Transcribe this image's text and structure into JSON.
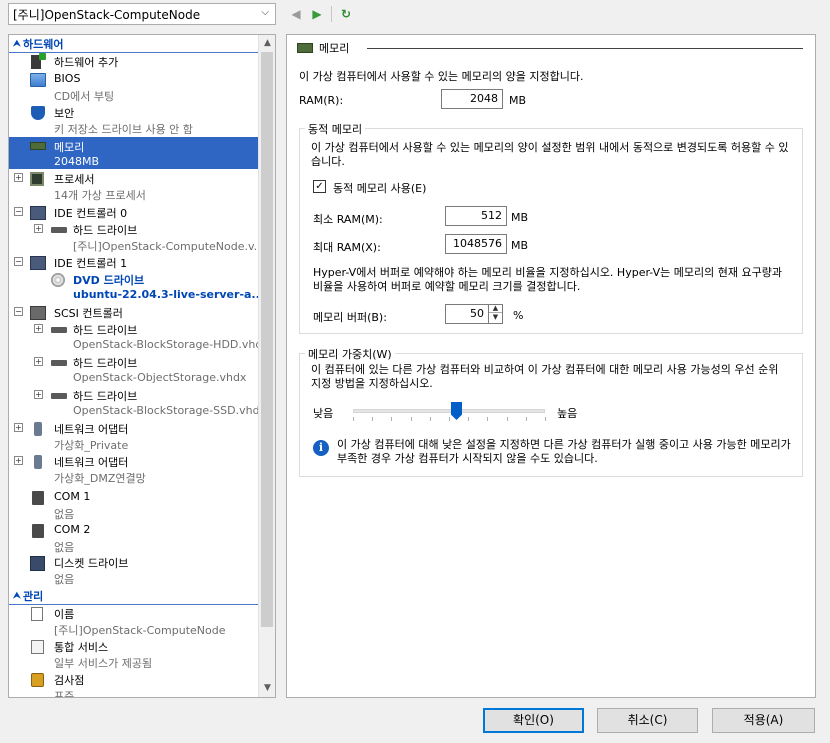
{
  "toolbar": {
    "vm_name": "[주니]OpenStack-ComputeNode",
    "back": "◀",
    "forward": "▶",
    "refresh": "↻"
  },
  "sidebar": {
    "hardware_header": "하드웨어",
    "management_header": "관리",
    "items": [
      {
        "title": "하드웨어 추가",
        "sub": ""
      },
      {
        "title": "BIOS",
        "sub": "CD에서 부팅"
      },
      {
        "title": "보안",
        "sub": "키 저장소 드라이브 사용 안 함"
      },
      {
        "title": "메모리",
        "sub": "2048MB"
      },
      {
        "title": "프로세서",
        "sub": "14개 가상 프로세서"
      },
      {
        "title": "IDE 컨트롤러 0",
        "sub": ""
      },
      {
        "title": "하드 드라이브",
        "sub": "[주니]OpenStack-ComputeNode.v..."
      },
      {
        "title": "IDE 컨트롤러 1",
        "sub": ""
      },
      {
        "title": "DVD 드라이브",
        "sub": "ubuntu-22.04.3-live-server-a..."
      },
      {
        "title": "SCSI 컨트롤러",
        "sub": ""
      },
      {
        "title": "하드 드라이브",
        "sub": "OpenStack-BlockStorage-HDD.vhdx"
      },
      {
        "title": "하드 드라이브",
        "sub": "OpenStack-ObjectStorage.vhdx"
      },
      {
        "title": "하드 드라이브",
        "sub": "OpenStack-BlockStorage-SSD.vhdx"
      },
      {
        "title": "네트워크 어댑터",
        "sub": "가상화_Private"
      },
      {
        "title": "네트워크 어댑터",
        "sub": "가상화_DMZ연결망"
      },
      {
        "title": "COM 1",
        "sub": "없음"
      },
      {
        "title": "COM 2",
        "sub": "없음"
      },
      {
        "title": "디스켓 드라이브",
        "sub": "없음"
      },
      {
        "title": "이름",
        "sub": "[주니]OpenStack-ComputeNode"
      },
      {
        "title": "통합 서비스",
        "sub": "일부 서비스가 제공됨"
      },
      {
        "title": "검사점",
        "sub": "표준"
      }
    ]
  },
  "memory": {
    "header": "메모리",
    "description": "이 가상 컴퓨터에서 사용할 수 있는 메모리의 양을 지정합니다.",
    "ram_label": "RAM(R):",
    "ram_value": "2048",
    "unit_mb": "MB",
    "dynamic": {
      "title": "동적 메모리",
      "description": "이 가상 컴퓨터에서 사용할 수 있는 메모리의 양이 설정한 범위 내에서 동적으로 변경되도록 허용할 수 있습니다.",
      "enable_label": "동적 메모리 사용(E)",
      "enable_mark": "✓",
      "min_label": "최소 RAM(M):",
      "min_value": "512",
      "max_label": "최대 RAM(X):",
      "max_value": "1048576",
      "buffer_note": "Hyper-V에서 버퍼로 예약해야 하는 메모리 비율을 지정하십시오. Hyper-V는 메모리의 현재 요구량과 비율을 사용하여 버퍼로 예약할 메모리 크기를 결정합니다.",
      "buffer_label": "메모리 버퍼(B):",
      "buffer_value": "50",
      "percent": "%"
    },
    "weight": {
      "title": "메모리 가중치(W)",
      "description": "이 컴퓨터에 있는 다른 가상 컴퓨터와 비교하여 이 가상 컴퓨터에 대한 메모리 사용 가능성의 우선 순위 지정 방법을 지정하십시오.",
      "low_label": "낮음",
      "high_label": "높음",
      "level": 0.5,
      "info": "이 가상 컴퓨터에 대해 낮은 설정을 지정하면 다른 가상 컴퓨터가 실행 중이고 사용 가능한 메모리가 부족한 경우 가상 컴퓨터가 시작되지 않을 수도 있습니다."
    }
  },
  "buttons": {
    "ok": "확인(O)",
    "cancel": "취소(C)",
    "apply": "적용(A)"
  }
}
